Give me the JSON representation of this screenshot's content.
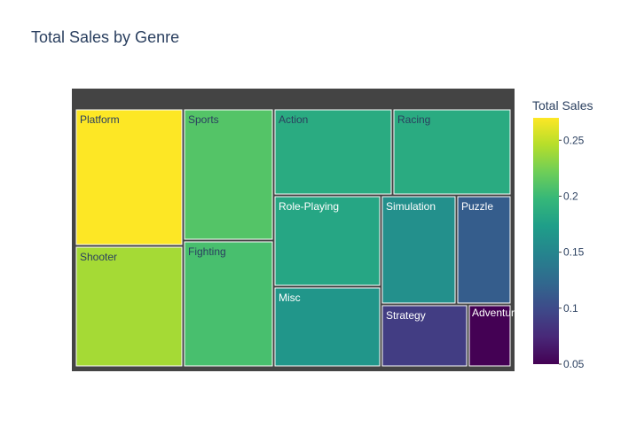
{
  "chart_data": {
    "type": "treemap",
    "title": "Total Sales by Genre",
    "colorbar_title": "Total Sales",
    "color_range": [
      0.05,
      0.27
    ],
    "colorbar_ticks": [
      "0.25",
      "0.2",
      "0.15",
      "0.1",
      "0.05"
    ],
    "colorbar_tick_values": [
      0.25,
      0.2,
      0.15,
      0.1,
      0.05
    ],
    "colorscale": "Viridis",
    "root_color": "#444444",
    "tiles": [
      {
        "name": "Platform",
        "value": 0.27
      },
      {
        "name": "Shooter",
        "value": 0.24
      },
      {
        "name": "Sports",
        "value": 0.21
      },
      {
        "name": "Fighting",
        "value": 0.205
      },
      {
        "name": "Action",
        "value": 0.185
      },
      {
        "name": "Racing",
        "value": 0.185
      },
      {
        "name": "Role-Playing",
        "value": 0.18
      },
      {
        "name": "Misc",
        "value": 0.165
      },
      {
        "name": "Simulation",
        "value": 0.16
      },
      {
        "name": "Puzzle",
        "value": 0.115
      },
      {
        "name": "Strategy",
        "value": 0.09
      },
      {
        "name": "Adventure",
        "value": 0.05
      }
    ]
  }
}
